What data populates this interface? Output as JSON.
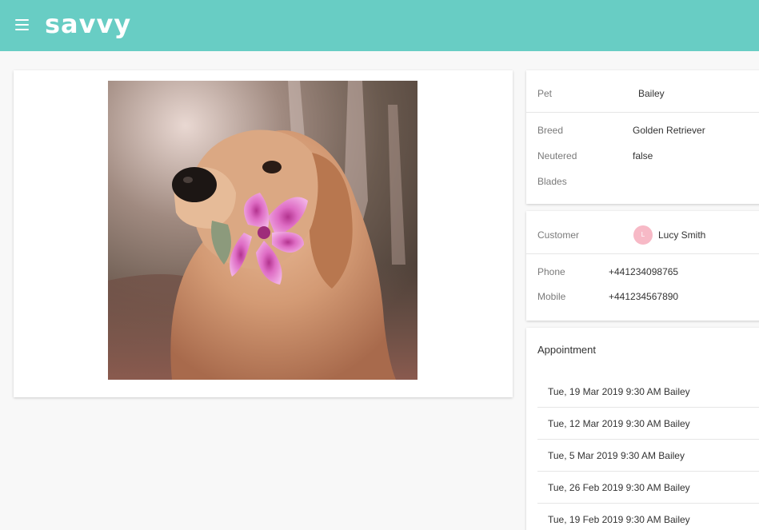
{
  "header": {
    "logo": "savvy"
  },
  "pet": {
    "name_label": "Pet",
    "name_value": "Bailey",
    "breed_label": "Breed",
    "breed_value": "Golden Retriever",
    "neutered_label": "Neutered",
    "neutered_value": "false",
    "blades_label": "Blades",
    "blades_value": ""
  },
  "customer": {
    "label": "Customer",
    "avatar_initial": "L",
    "name": "Lucy Smith",
    "phone_label": "Phone",
    "phone_value": "+441234098765",
    "mobile_label": "Mobile",
    "mobile_value": "+441234567890"
  },
  "appointments": {
    "title": "Appointment",
    "items": [
      "Tue, 19 Mar 2019 9:30 AM Bailey",
      "Tue, 12 Mar 2019 9:30 AM Bailey",
      "Tue, 5 Mar 2019 9:30 AM Bailey",
      "Tue, 26 Feb 2019 9:30 AM Bailey",
      "Tue, 19 Feb 2019 9:30 AM Bailey"
    ]
  },
  "colors": {
    "header": "#68cdc4",
    "avatar": "#f7b9c6",
    "background": "#f8f8f8"
  }
}
